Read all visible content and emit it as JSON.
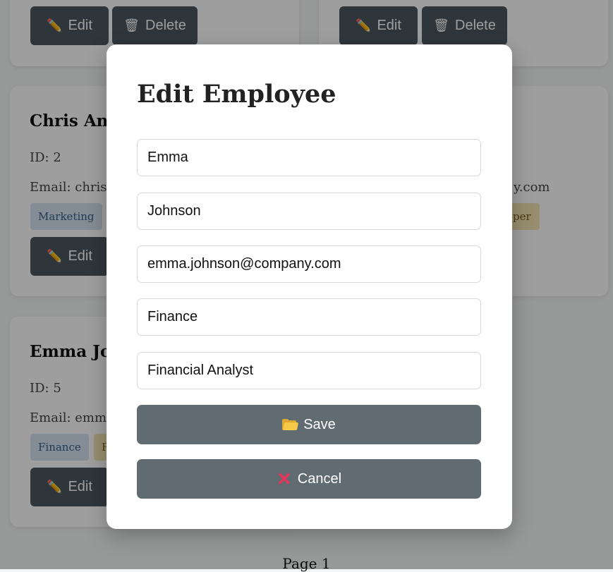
{
  "background_cards": [
    {
      "edit_label": "Edit",
      "delete_label": "Delete"
    },
    {
      "edit_label": "Edit",
      "delete_label": "Delete"
    },
    {
      "name": "Chris And",
      "id_text": "ID: 2",
      "email_text": "Email: chris.a",
      "department": "Marketing",
      "edit_label": "Edit"
    },
    {
      "email_tail": "y.com",
      "role_tail": "oper"
    },
    {
      "name": "Emma Jol",
      "id_text": "ID: 5",
      "email_text": "Email: emma",
      "department": "Finance",
      "role_fragment": "F",
      "edit_label": "Edit"
    }
  ],
  "pager": {
    "label": "Page 1"
  },
  "modal": {
    "title": "Edit Employee",
    "fields": {
      "first_name": "Emma",
      "last_name": "Johnson",
      "email": "emma.johnson@company.com",
      "department": "Finance",
      "position": "Financial Analyst"
    },
    "save_label": "Save",
    "cancel_label": "Cancel"
  },
  "icons": {
    "edit": "pencil-icon",
    "delete": "trash-icon",
    "save": "folder-icon",
    "cancel": "cross-icon"
  },
  "colors": {
    "button": "#4c5860",
    "modal_button": "#606b72",
    "dept_tag": "#d6e2f1",
    "role_tag": "#f4e6b3",
    "cancel_icon": "#e8345a"
  }
}
